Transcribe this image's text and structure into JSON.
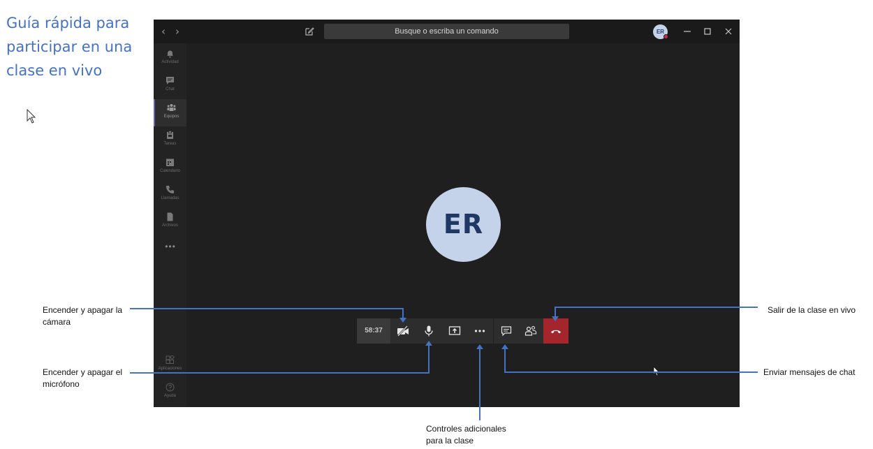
{
  "guide": {
    "title": "Guía rápida para participar en una clase en vivo"
  },
  "window": {
    "search_placeholder": "Busque o escriba un comando",
    "user_initials": "ER"
  },
  "rail": {
    "items": [
      {
        "label": "Actividad",
        "icon": "bell-icon"
      },
      {
        "label": "Chat",
        "icon": "chat-icon"
      },
      {
        "label": "Equipos",
        "icon": "teams-icon"
      },
      {
        "label": "Tareas",
        "icon": "assignments-icon"
      },
      {
        "label": "Calendario",
        "icon": "calendar-icon"
      },
      {
        "label": "Llamadas",
        "icon": "phone-icon"
      },
      {
        "label": "Archivos",
        "icon": "files-icon"
      }
    ],
    "bottom_items": [
      {
        "label": "Aplicaciones",
        "icon": "apps-icon"
      },
      {
        "label": "Ayuda",
        "icon": "help-icon"
      }
    ],
    "more": "•••"
  },
  "meeting": {
    "participant_initials": "ER",
    "timer": "58:37"
  },
  "callouts": {
    "camera": "Encender y apagar la cámara",
    "microphone": "Encender y apagar el micrófono",
    "more_controls": "Controles adicionales para la clase",
    "leave": "Salir de la clase en vivo",
    "chat": "Enviar mensajes de chat"
  },
  "colors": {
    "title_blue": "#4472c4",
    "callout_line": "#4472c4",
    "hangup_red": "#a4262c",
    "window_bg": "#1f1f1f",
    "avatar_bg": "#c5d3ea"
  }
}
